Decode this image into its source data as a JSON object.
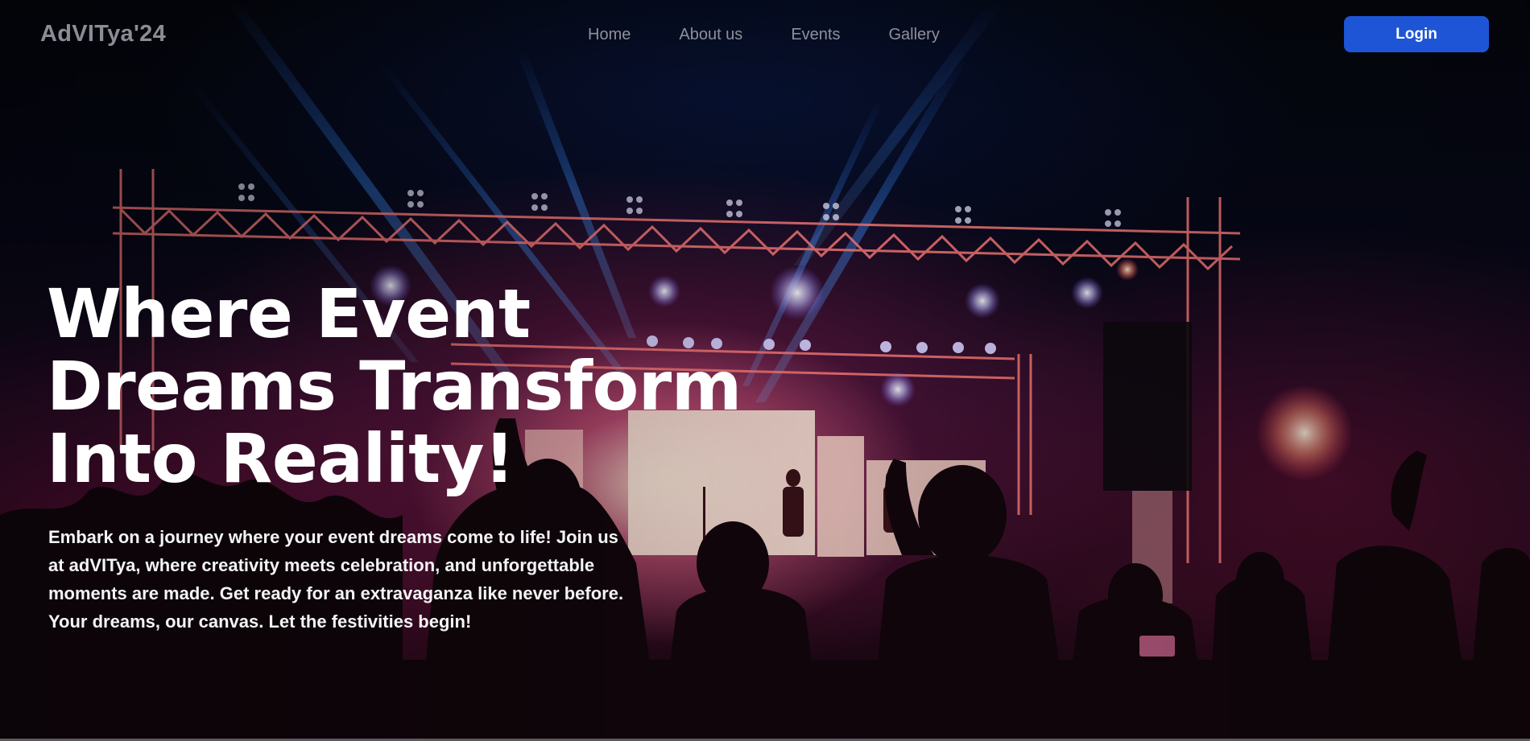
{
  "brand": {
    "name": "AdVITya'24"
  },
  "nav": {
    "links": [
      {
        "label": "Home"
      },
      {
        "label": "About us"
      },
      {
        "label": "Events"
      },
      {
        "label": "Gallery"
      }
    ],
    "login_label": "Login"
  },
  "hero": {
    "title_lines": [
      "Where Event",
      "Dreams Transform",
      "Into Reality!"
    ],
    "description": "Embark on a journey where your event dreams come to life! Join us at adVITya, where creativity meets celebration, and unforgettable moments are made. Get ready for an extravaganza like never before. Your dreams, our canvas. Let the festivities begin!"
  },
  "colors": {
    "brand_text": "#8a8c96",
    "nav_text": "#8e909a",
    "login_bg": "#1d55d6",
    "hero_text": "#ffffff"
  },
  "background": {
    "subject": "concert stage with truss lighting, laser beams and crowd silhouettes"
  }
}
